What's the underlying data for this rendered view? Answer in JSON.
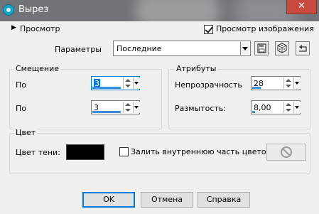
{
  "window": {
    "title": "Вырез",
    "close_glyph": "✕"
  },
  "preview": {
    "label": "Просмотр",
    "toggle_glyph": "▶",
    "checkbox_label": "Просмотр изображения",
    "checkbox_checked": true
  },
  "presets": {
    "label": "Параметры",
    "value": "Последние"
  },
  "offset": {
    "title": "Смещение",
    "rows": [
      {
        "label": "По",
        "value": "3"
      },
      {
        "label": "По",
        "value": "3"
      }
    ]
  },
  "attributes": {
    "title": "Атрибуты",
    "opacity_label": "Непрозрачность",
    "opacity_value": "28",
    "blur_label": "Размытость:",
    "blur_value": "8,00"
  },
  "color": {
    "title": "Цвет",
    "shadow_label": "Цвет тени:",
    "shadow_color": "#000000",
    "fill_label": "Залить внутреннюю часть цветом:",
    "fill_checked": false
  },
  "buttons": {
    "ok": "OK",
    "cancel": "Отмена",
    "help": "Справка"
  }
}
